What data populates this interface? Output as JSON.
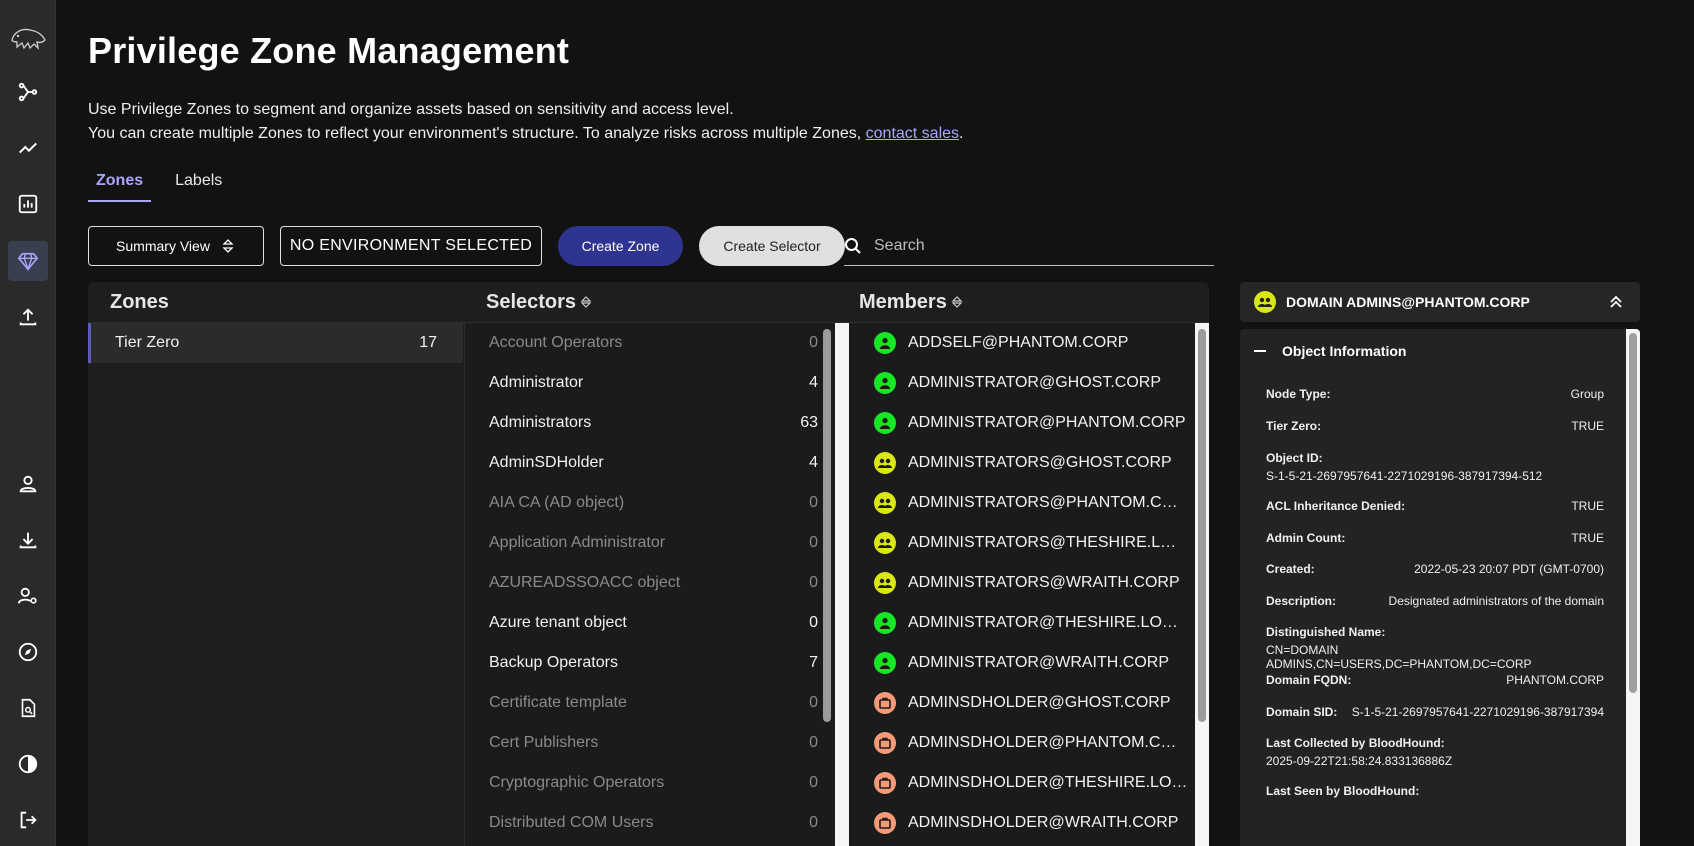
{
  "page": {
    "title": "Privilege Zone Management",
    "desc_line1": "Use Privilege Zones to segment and organize assets based on sensitivity and access level.",
    "desc_line2_prefix": "You can create multiple Zones to reflect your environment's structure. To analyze risks across multiple Zones, ",
    "desc_link": "contact sales",
    "desc_line2_suffix": "."
  },
  "tabs": [
    {
      "label": "Zones",
      "active": true
    },
    {
      "label": "Labels",
      "active": false
    }
  ],
  "toolbar": {
    "summary_view": "Summary View",
    "environment": "NO ENVIRONMENT SELECTED",
    "create_zone": "Create Zone",
    "create_selector": "Create Selector",
    "search_placeholder": "Search"
  },
  "columns": {
    "zones": "Zones",
    "selectors": "Selectors",
    "members": "Members"
  },
  "zones": [
    {
      "name": "Tier Zero",
      "count": "17"
    }
  ],
  "selectors": [
    {
      "name": "Account Operators",
      "count": "0",
      "dim": true
    },
    {
      "name": "Administrator",
      "count": "4",
      "dim": false
    },
    {
      "name": "Administrators",
      "count": "63",
      "dim": false
    },
    {
      "name": "AdminSDHolder",
      "count": "4",
      "dim": false
    },
    {
      "name": "AIA CA (AD object)",
      "count": "0",
      "dim": true
    },
    {
      "name": "Application Administrator",
      "count": "0",
      "dim": true
    },
    {
      "name": "AZUREADSSOACC object",
      "count": "0",
      "dim": true
    },
    {
      "name": "Azure tenant object",
      "count": "0",
      "dim": false
    },
    {
      "name": "Backup Operators",
      "count": "7",
      "dim": false
    },
    {
      "name": "Certificate template",
      "count": "0",
      "dim": true
    },
    {
      "name": "Cert Publishers",
      "count": "0",
      "dim": true
    },
    {
      "name": "Cryptographic Operators",
      "count": "0",
      "dim": true
    },
    {
      "name": "Distributed COM Users",
      "count": "0",
      "dim": true
    }
  ],
  "members": [
    {
      "name": "ADDSELF@PHANTOM.CORP",
      "type": "user"
    },
    {
      "name": "ADMINISTRATOR@GHOST.CORP",
      "type": "user"
    },
    {
      "name": "ADMINISTRATOR@PHANTOM.CORP",
      "type": "user"
    },
    {
      "name": "ADMINISTRATORS@GHOST.CORP",
      "type": "group"
    },
    {
      "name": "ADMINISTRATORS@PHANTOM.CORP",
      "type": "group"
    },
    {
      "name": "ADMINISTRATORS@THESHIRE.LOC…",
      "type": "group"
    },
    {
      "name": "ADMINISTRATORS@WRAITH.CORP",
      "type": "group"
    },
    {
      "name": "ADMINISTRATOR@THESHIRE.LOCAL",
      "type": "user"
    },
    {
      "name": "ADMINISTRATOR@WRAITH.CORP",
      "type": "user"
    },
    {
      "name": "ADMINSDHOLDER@GHOST.CORP",
      "type": "container"
    },
    {
      "name": "ADMINSDHOLDER@PHANTOM.CORP",
      "type": "container"
    },
    {
      "name": "ADMINSDHOLDER@THESHIRE.LOCAL",
      "type": "container"
    },
    {
      "name": "ADMINSDHOLDER@WRAITH.CORP",
      "type": "container"
    }
  ],
  "colors": {
    "user": "#17e625",
    "group": "#dbe617",
    "container": "#f79a78",
    "accent": "#a9a6ff",
    "primary_button": "#2f3490"
  },
  "detail": {
    "title": "DOMAIN ADMINS@PHANTOM.CORP",
    "section": "Object Information",
    "fields": [
      {
        "key": "Node Type:",
        "value": "Group",
        "layout": "inline"
      },
      {
        "key": "Tier Zero:",
        "value": "TRUE",
        "layout": "inline"
      },
      {
        "key": "Object ID:",
        "value": "S-1-5-21-2697957641-2271029196-387917394-512",
        "layout": "stack"
      },
      {
        "key": "ACL Inheritance Denied:",
        "value": "TRUE",
        "layout": "inline"
      },
      {
        "key": "Admin Count:",
        "value": "TRUE",
        "layout": "inline"
      },
      {
        "key": "Created:",
        "value": "2022-05-23 20:07 PDT (GMT-0700)",
        "layout": "inline"
      },
      {
        "key": "Description:",
        "value": "Designated administrators of the domain",
        "layout": "inline"
      },
      {
        "key": "Distinguished Name:",
        "value": "CN=DOMAIN ADMINS,CN=USERS,DC=PHANTOM,DC=CORP",
        "layout": "stack"
      },
      {
        "key": "Domain FQDN:",
        "value": "PHANTOM.CORP",
        "layout": "inline"
      },
      {
        "key": "Domain SID:",
        "value": "S-1-5-21-2697957641-2271029196-387917394",
        "layout": "inline"
      },
      {
        "key": "Last Collected by BloodHound:",
        "value": "2025-09-22T21:58:24.833136886Z",
        "layout": "stack"
      },
      {
        "key": "Last Seen by BloodHound:",
        "value": "",
        "layout": "stack"
      }
    ]
  },
  "nav_icons": [
    "logo-icon",
    "explore-icon",
    "trend-icon",
    "chart-icon",
    "gem-icon",
    "upload-icon",
    "user-icon",
    "download-icon",
    "user-gear-icon",
    "compass-icon",
    "file-search-icon",
    "contrast-icon",
    "logout-icon"
  ]
}
